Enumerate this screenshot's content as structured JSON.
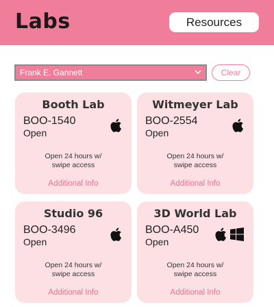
{
  "header": {
    "title": "Labs",
    "resources_label": "Resources"
  },
  "filter": {
    "selected": "Frank E. Gannett",
    "clear_label": "Clear"
  },
  "labs": [
    {
      "name": "Booth Lab",
      "code": "BOO-1540",
      "status": "Open",
      "hours_line1": "Open 24 hours w/",
      "hours_line2": "swipe access",
      "info_label": "Additional Info",
      "os": [
        "apple-icon"
      ]
    },
    {
      "name": "Witmeyer Lab",
      "code": "BOO-2554",
      "status": "Open",
      "hours_line1": "Open 24 hours w/",
      "hours_line2": "swipe access",
      "info_label": "Additional Info",
      "os": [
        "apple-icon"
      ]
    },
    {
      "name": "Studio 96",
      "code": "BOO-3496",
      "status": "Open",
      "hours_line1": "Open 24 hours w/",
      "hours_line2": "swipe access",
      "info_label": "Additional Info",
      "os": [
        "apple-icon"
      ]
    },
    {
      "name": "3D World Lab",
      "code": "BOO-A450",
      "status": "Open",
      "hours_line1": "Open 24 hours w/",
      "hours_line2": "swipe access",
      "info_label": "Additional Info",
      "os": [
        "apple-icon",
        "windows-icon"
      ]
    }
  ],
  "colors": {
    "accent": "#f07d99",
    "card_bg": "#fde0e4",
    "link": "#e8708d"
  }
}
